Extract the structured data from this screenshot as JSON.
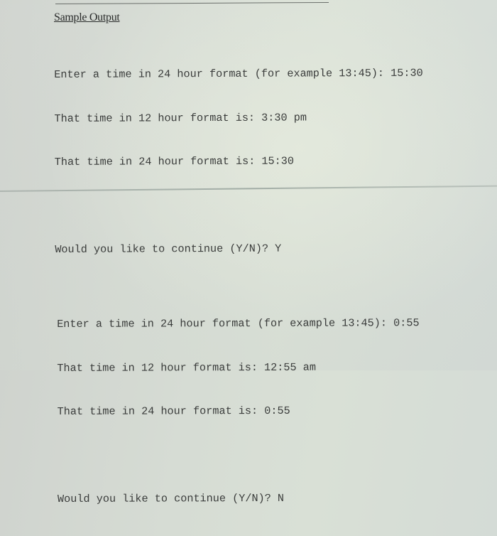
{
  "document": {
    "heading": "Sample Output",
    "runs": [
      {
        "prompt_line": "Enter a time in 24 hour format (for example 13:45): 15:30",
        "result_12h_line": "That time in 12 hour format is: 3:30 pm",
        "result_24h_line": "That time in 24 hour format is: 15:30",
        "continue_line": "Would you like to continue (Y/N)? Y"
      },
      {
        "prompt_line": "Enter a time in 24 hour format (for example 13:45): 0:55",
        "result_12h_line": "That time in 12 hour format is: 12:55 am",
        "result_24h_line": "That time in 24 hour format is: 0:55",
        "continue_line": "Would you like to continue (Y/N)? N"
      }
    ]
  }
}
